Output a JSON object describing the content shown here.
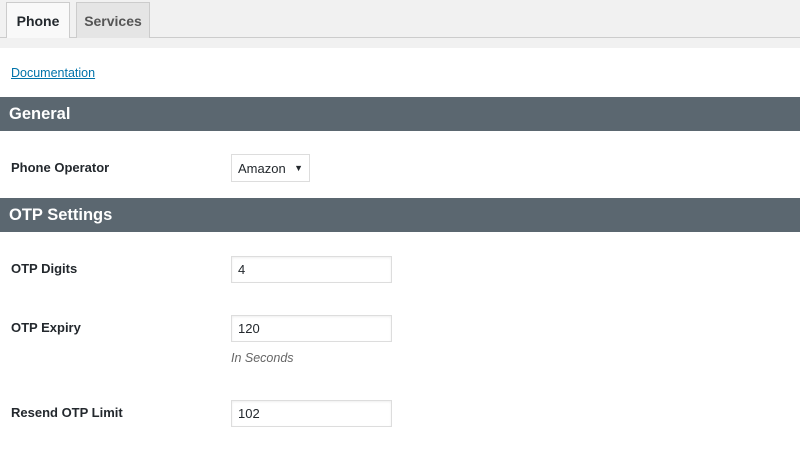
{
  "tabs": [
    {
      "label": "Phone",
      "active": true
    },
    {
      "label": "Services",
      "active": false
    }
  ],
  "documentation_link": "Documentation",
  "sections": {
    "general": {
      "title": "General",
      "phone_operator": {
        "label": "Phone Operator",
        "value": "Amazon"
      }
    },
    "otp": {
      "title": "OTP Settings",
      "digits": {
        "label": "OTP Digits",
        "value": "4"
      },
      "expiry": {
        "label": "OTP Expiry",
        "value": "120",
        "hint": "In Seconds"
      },
      "resend_limit": {
        "label": "Resend OTP Limit",
        "value": "102"
      }
    }
  },
  "colors": {
    "section_bar": "#5b6770",
    "link": "#0073aa",
    "tab_bar": "#f1f1f1"
  }
}
